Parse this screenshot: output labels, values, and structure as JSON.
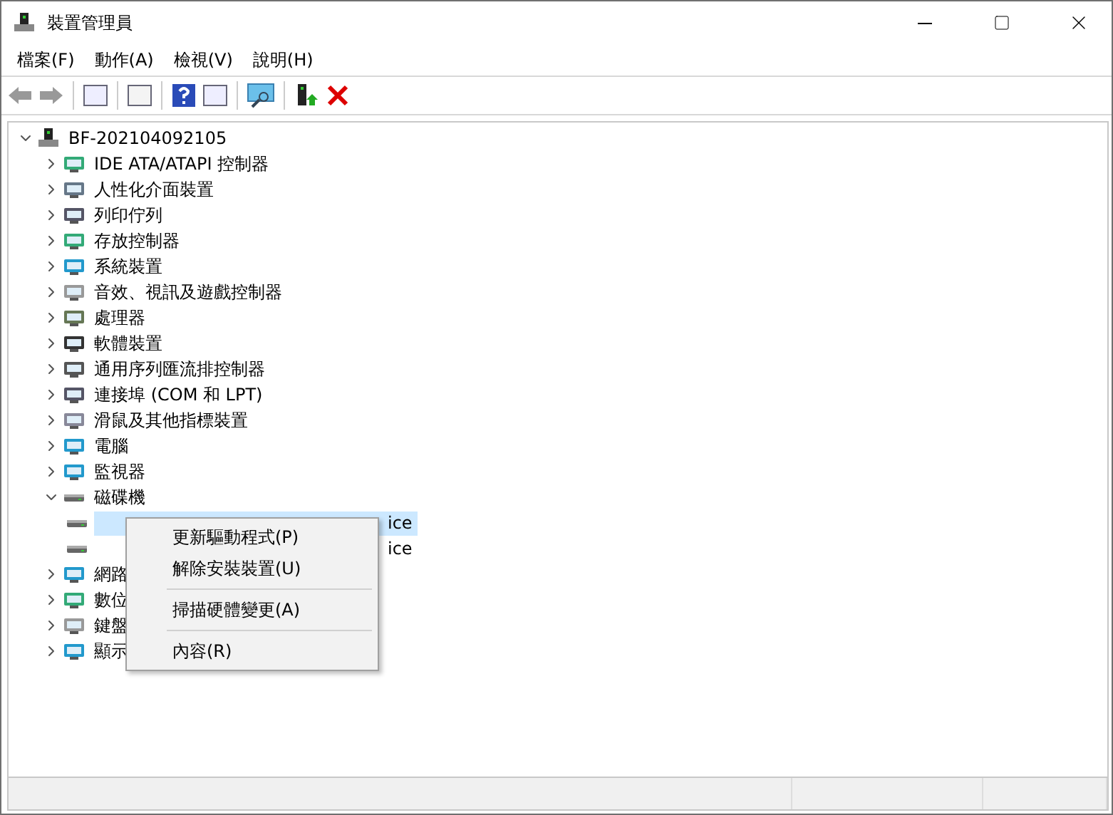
{
  "window": {
    "title": "裝置管理員"
  },
  "menu": [
    "檔案(F)",
    "動作(A)",
    "檢視(V)",
    "說明(H)"
  ],
  "tree": {
    "label": "BF-202104092105",
    "expanded": true,
    "children": [
      {
        "label": "IDE ATA/ATAPI 控制器",
        "expanded": false,
        "selected": false
      },
      {
        "label": "人性化介面裝置",
        "expanded": false,
        "selected": false
      },
      {
        "label": "列印佇列",
        "expanded": false,
        "selected": false
      },
      {
        "label": "存放控制器",
        "expanded": false,
        "selected": false
      },
      {
        "label": "系統裝置",
        "expanded": false,
        "selected": false
      },
      {
        "label": "音效、視訊及遊戲控制器",
        "expanded": false,
        "selected": false
      },
      {
        "label": "處理器",
        "expanded": false,
        "selected": false
      },
      {
        "label": "軟體裝置",
        "expanded": false,
        "selected": false
      },
      {
        "label": "通用序列匯流排控制器",
        "expanded": false,
        "selected": false
      },
      {
        "label": "連接埠 (COM 和 LPT)",
        "expanded": false,
        "selected": false
      },
      {
        "label": "滑鼠及其他指標裝置",
        "expanded": false,
        "selected": false
      },
      {
        "label": "電腦",
        "expanded": false,
        "selected": false
      },
      {
        "label": "監視器",
        "expanded": false,
        "selected": false
      },
      {
        "label": "磁碟機",
        "expanded": true,
        "selected": false,
        "children": [
          {
            "label": "ice",
            "selected": true
          },
          {
            "label": "ice",
            "selected": false
          }
        ]
      },
      {
        "label": "網路",
        "expanded": false,
        "selected": false
      },
      {
        "label": "數位",
        "expanded": false,
        "selected": false
      },
      {
        "label": "鍵盤",
        "expanded": false,
        "selected": false
      },
      {
        "label": "顯示",
        "expanded": false,
        "selected": false
      }
    ]
  },
  "context_menu": [
    {
      "kind": "item",
      "label": "更新驅動程式(P)"
    },
    {
      "kind": "item",
      "label": "解除安裝裝置(U)"
    },
    {
      "kind": "separator"
    },
    {
      "kind": "item",
      "label": "掃描硬體變更(A)"
    },
    {
      "kind": "separator"
    },
    {
      "kind": "item",
      "label": "內容(R)"
    }
  ]
}
